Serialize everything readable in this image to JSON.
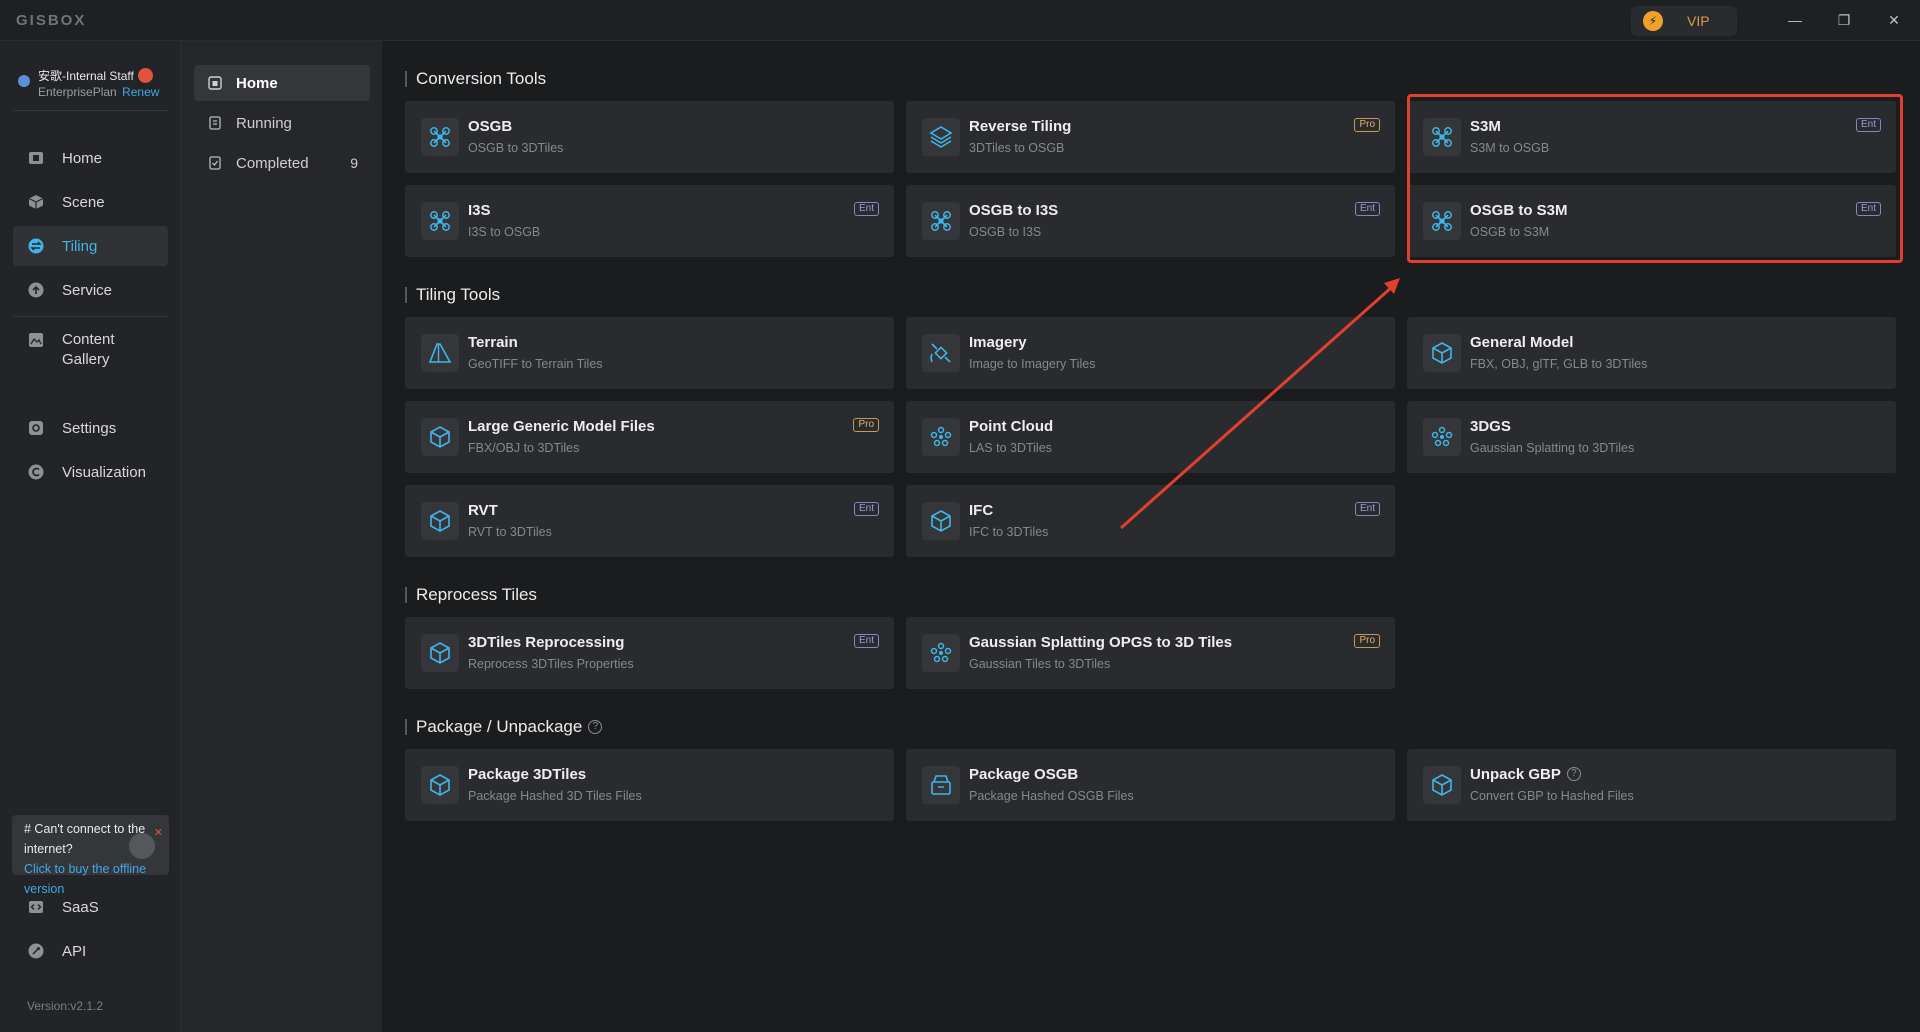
{
  "app": {
    "logo": "GISBOX",
    "vip_label": "VIP",
    "vip_icon": "⚡",
    "window_controls": [
      "—",
      "❐",
      "✕"
    ]
  },
  "user": {
    "name": "安歌-Internal Staff",
    "plan": "EnterprisePlan",
    "renew": "Renew"
  },
  "nav": {
    "items": [
      {
        "label": "Home",
        "icon": "home-icon"
      },
      {
        "label": "Scene",
        "icon": "cube-icon"
      },
      {
        "label": "Tiling",
        "icon": "tiling-icon"
      },
      {
        "label": "Service",
        "icon": "upload-icon"
      },
      {
        "label": "Content Gallery",
        "icon": "gallery-icon"
      },
      {
        "label": "Settings",
        "icon": "gear-icon"
      },
      {
        "label": "Visualization",
        "icon": "visualization-icon"
      },
      {
        "label": "SaaS",
        "icon": "code-icon"
      },
      {
        "label": "API",
        "icon": "api-icon"
      }
    ],
    "offline": {
      "line1": "# Can't connect to the internet?",
      "line2": "Click to buy the offline version",
      "close": "✕"
    },
    "version": "Version:v2.1.2"
  },
  "subnav": {
    "items": [
      {
        "label": "Home"
      },
      {
        "label": "Running"
      },
      {
        "label": "Completed",
        "count": "9"
      }
    ]
  },
  "sections": {
    "conversion": {
      "title": "Conversion Tools",
      "cards": [
        {
          "title": "OSGB",
          "sub": "OSGB to 3DTiles",
          "badge": ""
        },
        {
          "title": "Reverse Tiling",
          "sub": "3DTiles to OSGB",
          "badge": "Pro"
        },
        {
          "title": "S3M",
          "sub": "S3M to OSGB",
          "badge": "Ent"
        },
        {
          "title": "I3S",
          "sub": "I3S to OSGB",
          "badge": "Ent"
        },
        {
          "title": "OSGB to I3S",
          "sub": "OSGB to I3S",
          "badge": "Ent"
        },
        {
          "title": "OSGB to S3M",
          "sub": "OSGB to S3M",
          "badge": "Ent"
        }
      ]
    },
    "tiling": {
      "title": "Tiling Tools",
      "cards": [
        {
          "title": "Terrain",
          "sub": "GeoTIFF to Terrain Tiles",
          "badge": ""
        },
        {
          "title": "Imagery",
          "sub": "Image to Imagery Tiles",
          "badge": ""
        },
        {
          "title": "General Model",
          "sub": "FBX, OBJ, glTF, GLB to 3DTiles",
          "badge": ""
        },
        {
          "title": "Large Generic Model Files",
          "sub": "FBX/OBJ to 3DTiles",
          "badge": "Pro"
        },
        {
          "title": "Point Cloud",
          "sub": "LAS to 3DTiles",
          "badge": ""
        },
        {
          "title": "3DGS",
          "sub": "Gaussian Splatting to 3DTiles",
          "badge": ""
        },
        {
          "title": "RVT",
          "sub": "RVT to 3DTiles",
          "badge": "Ent"
        },
        {
          "title": "IFC",
          "sub": "IFC to 3DTiles",
          "badge": "Ent"
        }
      ]
    },
    "reprocess": {
      "title": "Reprocess Tiles",
      "cards": [
        {
          "title": "3DTiles Reprocessing",
          "sub": "Reprocess 3DTiles Properties",
          "badge": "Ent"
        },
        {
          "title": "Gaussian Splatting OPGS to 3D Tiles",
          "sub": "Gaussian Tiles to 3DTiles",
          "badge": "Pro"
        }
      ]
    },
    "package": {
      "title": "Package / Unpackage",
      "help": "?",
      "cards": [
        {
          "title": "Package 3DTiles",
          "sub": "Package Hashed 3D Tiles Files",
          "badge": ""
        },
        {
          "title": "Package OSGB",
          "sub": "Package Hashed OSGB Files",
          "badge": ""
        },
        {
          "title": "Unpack GBP",
          "sub": "Convert GBP to Hashed Files",
          "badge": "",
          "help": "?"
        }
      ]
    }
  },
  "colors": {
    "accent": "#3fb6e8",
    "annotation": "#e0402f"
  }
}
